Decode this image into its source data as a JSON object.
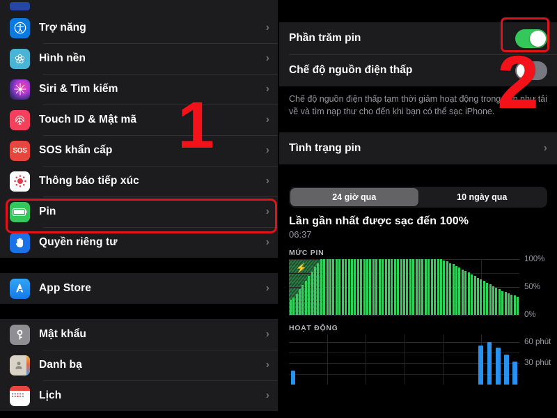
{
  "left_panel": {
    "partial_top_item": {
      "label": "",
      "icon": "partial-blue-icon"
    },
    "groups": [
      {
        "items": [
          {
            "label": "Trợ năng",
            "icon": "accessibility-icon",
            "chevron": "›"
          },
          {
            "label": "Hình nền",
            "icon": "wallpaper-icon",
            "chevron": "›"
          },
          {
            "label": "Siri & Tìm kiếm",
            "icon": "siri-icon",
            "chevron": "›"
          },
          {
            "label": "Touch ID & Mật mã",
            "icon": "touchid-icon",
            "chevron": "›"
          },
          {
            "label": "SOS khẩn cấp",
            "icon": "sos-icon",
            "chevron": "›"
          },
          {
            "label": "Thông báo tiếp xúc",
            "icon": "exposure-notification-icon",
            "chevron": "›"
          },
          {
            "label": "Pin",
            "icon": "battery-icon",
            "chevron": "›",
            "highlighted": true
          },
          {
            "label": "Quyền riêng tư",
            "icon": "privacy-hand-icon",
            "chevron": "›"
          }
        ]
      },
      {
        "items": [
          {
            "label": "App Store",
            "icon": "app-store-icon",
            "chevron": "›"
          }
        ]
      },
      {
        "items": [
          {
            "label": "Mật khẩu",
            "icon": "passwords-key-icon",
            "chevron": "›"
          },
          {
            "label": "Danh bạ",
            "icon": "contacts-icon",
            "chevron": "›"
          },
          {
            "label": "Lịch",
            "icon": "calendar-icon",
            "chevron": "›"
          }
        ]
      }
    ]
  },
  "right_panel": {
    "rows": [
      {
        "label": "Phần trăm pin",
        "toggle": "on"
      },
      {
        "label": "Chế độ nguồn điện thấp",
        "toggle": "off"
      }
    ],
    "footnote": "Chế độ nguồn điện thấp tạm thời giảm hoạt động trong nền như tải về và tìm nạp thư cho đến khi bạn có thể sạc iPhone.",
    "battery_health_row": {
      "label": "Tình trạng pin",
      "chevron": "›"
    },
    "segmented": {
      "options": [
        "24 giờ qua",
        "10 ngày qua"
      ],
      "selected_index": 0
    },
    "last_charge_title": "Lần gần nhất được sạc đến 100%",
    "last_charge_time": "06:37"
  },
  "annotations": {
    "marker_one": "1",
    "marker_two": "2",
    "accent_color": "#e0131b"
  },
  "chart_data": [
    {
      "type": "bar",
      "title": "MỨC PIN",
      "ylabel": "",
      "xlabel": "",
      "ylim": [
        0,
        100
      ],
      "ytick_labels": [
        "100%",
        "50%",
        "0%"
      ],
      "yticks": [
        100,
        50,
        0
      ],
      "grid": true,
      "bar_color": "#30d158",
      "charging_overlay_color": "#2c7a44",
      "charging_icon": "⚡",
      "values": [
        28,
        31,
        38,
        46,
        54,
        62,
        70,
        78,
        86,
        93,
        100,
        100,
        100,
        100,
        100,
        100,
        100,
        100,
        100,
        100,
        100,
        100,
        100,
        100,
        100,
        100,
        100,
        100,
        100,
        100,
        100,
        100,
        100,
        100,
        100,
        100,
        100,
        100,
        100,
        100,
        100,
        100,
        100,
        100,
        100,
        100,
        100,
        100,
        100,
        100,
        98,
        96,
        93,
        91,
        88,
        85,
        82,
        79,
        76,
        73,
        70,
        67,
        64,
        61,
        58,
        55,
        52,
        49,
        46,
        43,
        41,
        39,
        37,
        35,
        33
      ],
      "charging_values": [
        100,
        100,
        100,
        100,
        100,
        100,
        100,
        100,
        100,
        100,
        100,
        0,
        0,
        0,
        0,
        0,
        0,
        0,
        0,
        0,
        0,
        0,
        0,
        0,
        0,
        0,
        0,
        0,
        0,
        0,
        0,
        0,
        0,
        0,
        0,
        0,
        0,
        0,
        0,
        0,
        0,
        0,
        0,
        0,
        0,
        0,
        0,
        0,
        0,
        0,
        0,
        0,
        0,
        0,
        0,
        0,
        0,
        0,
        0,
        0,
        0,
        0,
        0,
        0,
        0,
        0,
        0,
        0,
        0,
        0,
        0,
        0,
        0,
        0,
        0
      ]
    },
    {
      "type": "bar",
      "title": "HOẠT ĐỘNG",
      "ylabel": "",
      "xlabel": "",
      "ylim": [
        0,
        70
      ],
      "ytick_labels": [
        "60 phút",
        "30 phút"
      ],
      "yticks": [
        60,
        30
      ],
      "grid": true,
      "bar_color": "#2792f0",
      "values": [
        20,
        0,
        0,
        0,
        0,
        0,
        0,
        0,
        0,
        0,
        0,
        0,
        0,
        0,
        0,
        0,
        0,
        0,
        0,
        0,
        0,
        0,
        55,
        60,
        52,
        42,
        32
      ]
    }
  ]
}
